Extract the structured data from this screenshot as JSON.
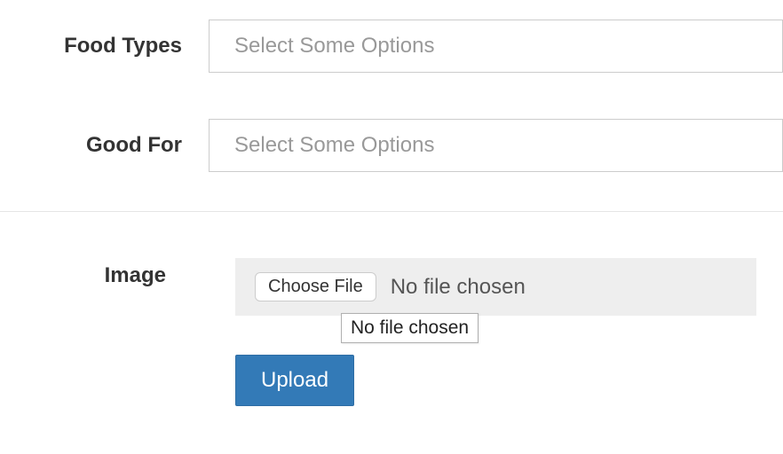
{
  "fields": {
    "food_types": {
      "label": "Food Types",
      "placeholder": "Select Some Options"
    },
    "good_for": {
      "label": "Good For",
      "placeholder": "Select Some Options"
    },
    "image": {
      "label": "Image",
      "choose_button": "Choose File",
      "status": "No file chosen",
      "tooltip": "No file chosen",
      "upload_button": "Upload"
    }
  }
}
